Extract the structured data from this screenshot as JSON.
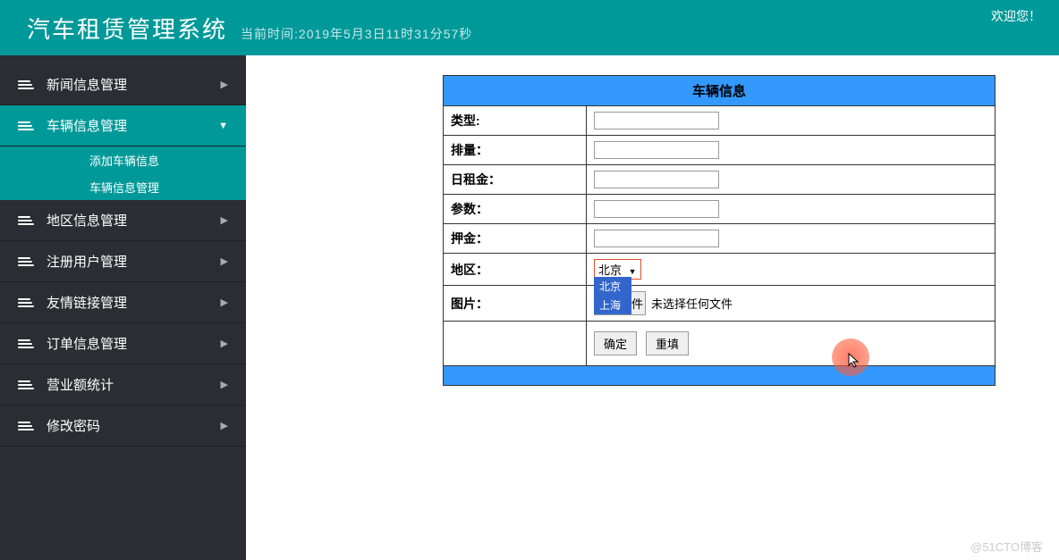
{
  "header": {
    "title": "汽车租赁管理系统",
    "time_prefix": "当前时间:",
    "time_value": "2019年5月3日11时31分57秒",
    "welcome": "欢迎您！"
  },
  "sidebar": {
    "items": [
      {
        "label": "新闻信息管理",
        "active": false,
        "expanded": false
      },
      {
        "label": "车辆信息管理",
        "active": true,
        "expanded": true,
        "children": [
          {
            "label": "添加车辆信息"
          },
          {
            "label": "车辆信息管理"
          }
        ]
      },
      {
        "label": "地区信息管理",
        "active": false,
        "expanded": false
      },
      {
        "label": "注册用户管理",
        "active": false,
        "expanded": false
      },
      {
        "label": "友情链接管理",
        "active": false,
        "expanded": false
      },
      {
        "label": "订单信息管理",
        "active": false,
        "expanded": false
      },
      {
        "label": "营业额统计",
        "active": false,
        "expanded": false
      },
      {
        "label": "修改密码",
        "active": false,
        "expanded": false
      }
    ]
  },
  "form": {
    "title": "车辆信息",
    "fields": {
      "type": "类型:",
      "displacement": "排量：",
      "daily_rent": "日租金：",
      "params": "参数：",
      "deposit": "押金：",
      "region": "地区：",
      "image": "图片："
    },
    "region_select": {
      "selected": "北京",
      "options": [
        "北京",
        "上海"
      ]
    },
    "file": {
      "button": "选择文件",
      "no_file": "未选择任何文件"
    },
    "buttons": {
      "submit": "确定",
      "reset": "重填"
    }
  },
  "watermark": "@51CTO博客"
}
